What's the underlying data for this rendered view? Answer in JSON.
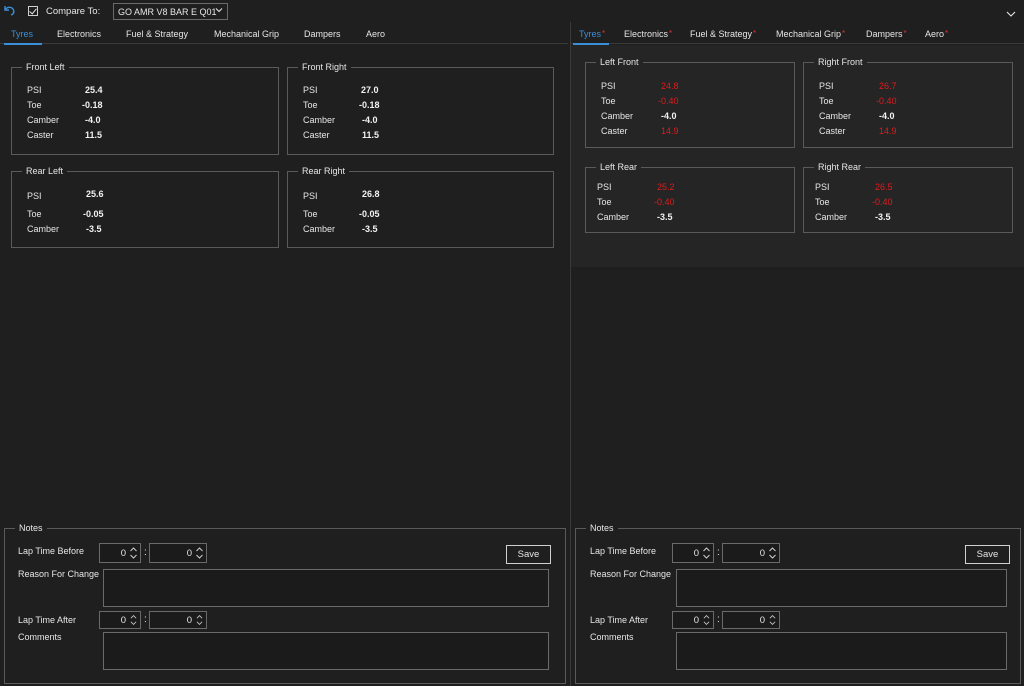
{
  "topbar": {
    "compare_label": "Compare To:",
    "compare_checked": true,
    "compare_selected": "GO AMR V8 BAR E Q01"
  },
  "left": {
    "tabs": [
      {
        "label": "Tyres",
        "modified": false,
        "active": true
      },
      {
        "label": "Electronics",
        "modified": false,
        "active": false
      },
      {
        "label": "Fuel & Strategy",
        "modified": false,
        "active": false
      },
      {
        "label": "Mechanical Grip",
        "modified": false,
        "active": false
      },
      {
        "label": "Dampers",
        "modified": false,
        "active": false
      },
      {
        "label": "Aero",
        "modified": false,
        "active": false
      }
    ],
    "groups": {
      "front_left": {
        "title": "Front Left",
        "psi_label": "PSI",
        "psi": "25.4",
        "toe_label": "Toe",
        "toe": "-0.18",
        "camber_label": "Camber",
        "camber": "-4.0",
        "caster_label": "Caster",
        "caster": "11.5"
      },
      "front_right": {
        "title": "Front Right",
        "psi_label": "PSI",
        "psi": "27.0",
        "toe_label": "Toe",
        "toe": "-0.18",
        "camber_label": "Camber",
        "camber": "-4.0",
        "caster_label": "Caster",
        "caster": "11.5"
      },
      "rear_left": {
        "title": "Rear Left",
        "psi_label": "PSI",
        "psi": "25.6",
        "toe_label": "Toe",
        "toe": "-0.05",
        "camber_label": "Camber",
        "camber": "-3.5"
      },
      "rear_right": {
        "title": "Rear Right",
        "psi_label": "PSI",
        "psi": "26.8",
        "toe_label": "Toe",
        "toe": "-0.05",
        "camber_label": "Camber",
        "camber": "-3.5"
      }
    },
    "notes": {
      "title": "Notes",
      "lap_before_label": "Lap Time Before",
      "lap_before_min": "0",
      "lap_before_sec": "0",
      "reason_label": "Reason For Change",
      "lap_after_label": "Lap Time After",
      "lap_after_min": "0",
      "lap_after_sec": "0",
      "comments_label": "Comments",
      "colon": ":",
      "save_label": "Save"
    }
  },
  "right": {
    "tabs": [
      {
        "label": "Tyres",
        "modified": true,
        "active": true
      },
      {
        "label": "Electronics",
        "modified": true,
        "active": false
      },
      {
        "label": "Fuel & Strategy",
        "modified": true,
        "active": false
      },
      {
        "label": "Mechanical Grip",
        "modified": true,
        "active": false
      },
      {
        "label": "Dampers",
        "modified": true,
        "active": false
      },
      {
        "label": "Aero",
        "modified": true,
        "active": false
      }
    ],
    "modified_marker": "*",
    "groups": {
      "left_front": {
        "title": "Left Front",
        "psi_label": "PSI",
        "psi": "24.8",
        "toe_label": "Toe",
        "toe": "-0.40",
        "camber_label": "Camber",
        "camber": "-4.0",
        "caster_label": "Caster",
        "caster": "14.9"
      },
      "right_front": {
        "title": "Right Front",
        "psi_label": "PSI",
        "psi": "26.7",
        "toe_label": "Toe",
        "toe": "-0.40",
        "camber_label": "Camber",
        "camber": "-4.0",
        "caster_label": "Caster",
        "caster": "14.9"
      },
      "left_rear": {
        "title": "Left Rear",
        "psi_label": "PSI",
        "psi": "25.2",
        "toe_label": "Toe",
        "toe": "-0.40",
        "camber_label": "Camber",
        "camber": "-3.5"
      },
      "right_rear": {
        "title": "Right Rear",
        "psi_label": "PSI",
        "psi": "26.5",
        "toe_label": "Toe",
        "toe": "-0.40",
        "camber_label": "Camber",
        "camber": "-3.5"
      }
    },
    "notes": {
      "title": "Notes",
      "lap_before_label": "Lap Time Before",
      "lap_before_min": "0",
      "lap_before_sec": "0",
      "reason_label": "Reason For Change",
      "lap_after_label": "Lap Time After",
      "lap_after_min": "0",
      "lap_after_sec": "0",
      "comments_label": "Comments",
      "colon": ":",
      "save_label": "Save"
    }
  },
  "colors": {
    "background": "#1f1f1f",
    "accent": "#3b8fd9",
    "changed_value": "#e01b1b",
    "border": "#5a5a5a"
  },
  "icons": [
    "undo-icon",
    "checkbox-check-icon",
    "chevron-down-icon",
    "spin-up-icon",
    "spin-down-icon"
  ]
}
